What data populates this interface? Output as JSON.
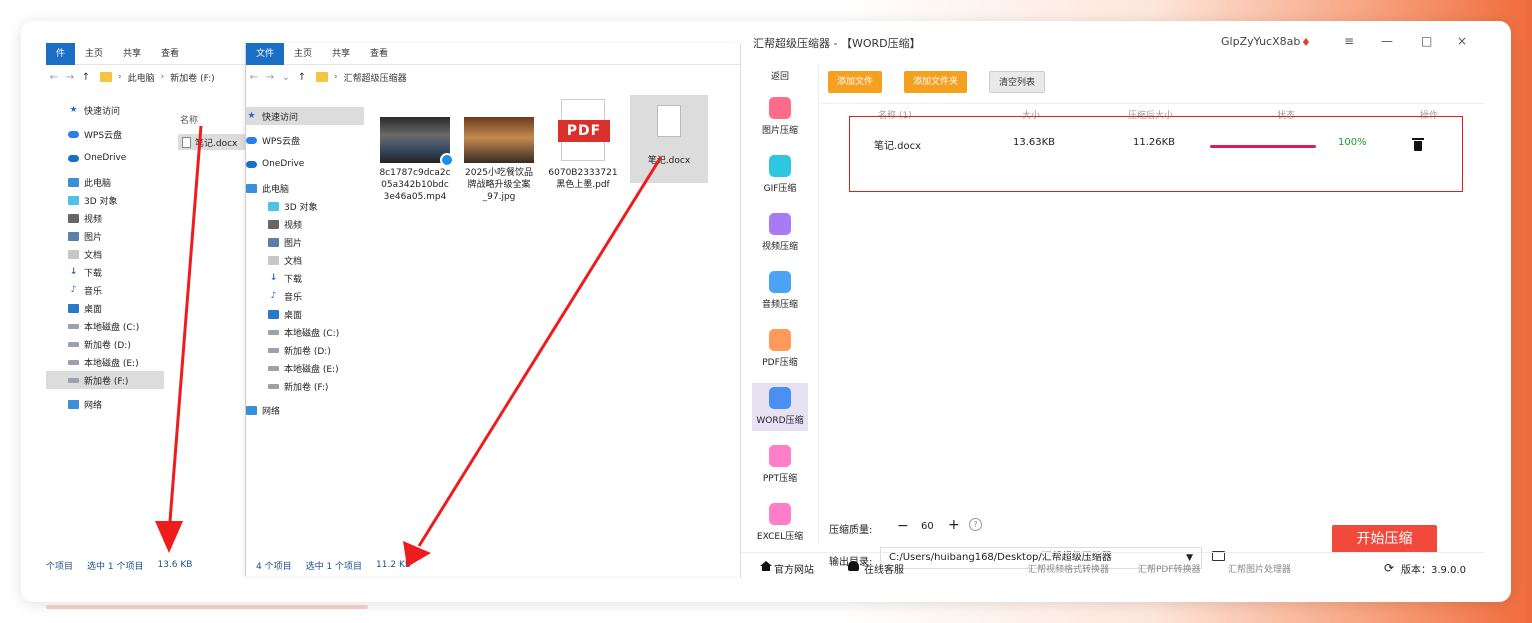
{
  "explorer_left": {
    "ribbon": [
      "件",
      "主页",
      "共享",
      "查看"
    ],
    "address": [
      "此电脑",
      "新加卷 (F:)"
    ],
    "nav": [
      {
        "label": "快速访问",
        "icon": "star-icon",
        "top": true
      },
      {
        "label": "WPS云盘",
        "icon": "cloud-icon",
        "top": true
      },
      {
        "label": "OneDrive",
        "icon": "onedrive-icon",
        "top": true
      },
      {
        "label": "此电脑",
        "icon": "pc-icon",
        "top": true
      },
      {
        "label": "3D 对象",
        "icon": "3d-icon"
      },
      {
        "label": "视频",
        "icon": "video-icon"
      },
      {
        "label": "图片",
        "icon": "picture-icon"
      },
      {
        "label": "文档",
        "icon": "document-icon"
      },
      {
        "label": "下载",
        "icon": "download-icon"
      },
      {
        "label": "音乐",
        "icon": "music-icon"
      },
      {
        "label": "桌面",
        "icon": "desktop-icon"
      },
      {
        "label": "本地磁盘 (C:)",
        "icon": "disk-icon"
      },
      {
        "label": "新加卷 (D:)",
        "icon": "disk-icon"
      },
      {
        "label": "本地磁盘 (E:)",
        "icon": "disk-icon"
      },
      {
        "label": "新加卷 (F:)",
        "icon": "disk-icon",
        "selected": true
      },
      {
        "label": "网络",
        "icon": "network-icon",
        "top": true
      }
    ],
    "col_name": "名称",
    "file": "笔记.docx",
    "status": [
      "个项目",
      "选中 1 个项目",
      "13.6 KB"
    ]
  },
  "explorer_right": {
    "ribbon": [
      "文件",
      "主页",
      "共享",
      "查看"
    ],
    "address": [
      "汇帮超级压缩器"
    ],
    "nav": [
      {
        "label": "快速访问",
        "icon": "star-icon",
        "top": true,
        "selected": true
      },
      {
        "label": "WPS云盘",
        "icon": "cloud-icon",
        "top": true
      },
      {
        "label": "OneDrive",
        "icon": "onedrive-icon",
        "top": true
      },
      {
        "label": "此电脑",
        "icon": "pc-icon",
        "top": true
      },
      {
        "label": "3D 对象",
        "icon": "3d-icon"
      },
      {
        "label": "视频",
        "icon": "video-icon"
      },
      {
        "label": "图片",
        "icon": "picture-icon"
      },
      {
        "label": "文档",
        "icon": "document-icon"
      },
      {
        "label": "下载",
        "icon": "download-icon"
      },
      {
        "label": "音乐",
        "icon": "music-icon"
      },
      {
        "label": "桌面",
        "icon": "desktop-icon"
      },
      {
        "label": "本地磁盘 (C:)",
        "icon": "disk-icon"
      },
      {
        "label": "新加卷 (D:)",
        "icon": "disk-icon"
      },
      {
        "label": "本地磁盘 (E:)",
        "icon": "disk-icon"
      },
      {
        "label": "新加卷 (F:)",
        "icon": "disk-icon"
      },
      {
        "label": "网络",
        "icon": "network-icon",
        "top": true
      }
    ],
    "files": [
      {
        "name1": "8c1787c9dca2c",
        "name2": "05a342b10bdc",
        "name3": "3e46a05.mp4"
      },
      {
        "name1": "2025小吃餐饮品",
        "name2": "牌战略升级全案",
        "name3": "_97.jpg"
      },
      {
        "name1": "6070B2333721",
        "name2": "黑色上墨.pdf",
        "name3": "",
        "badge": "PDF"
      },
      {
        "name1": "笔记.docx",
        "name2": "",
        "name3": ""
      }
    ],
    "status": [
      "4 个项目",
      "选中 1 个项目",
      "11.2 KB"
    ]
  },
  "app": {
    "title": "汇帮超级压缩器 - 【WORD压缩】",
    "user": "GlpZyYucX8ab",
    "window_controls": [
      "≡",
      "—",
      "□",
      "×"
    ],
    "back": "返回",
    "sidebar": [
      {
        "label": "图片压缩",
        "color": "#ff6b8a"
      },
      {
        "label": "GIF压缩",
        "color": "#2ec6e0"
      },
      {
        "label": "视频压缩",
        "color": "#a77bf2"
      },
      {
        "label": "音频压缩",
        "color": "#4aa3f5"
      },
      {
        "label": "PDF压缩",
        "color": "#ff9a5a"
      },
      {
        "label": "WORD压缩",
        "color": "#4a90f2",
        "active": true
      },
      {
        "label": "PPT压缩",
        "color": "#ff7ec8"
      },
      {
        "label": "EXCEL压缩",
        "color": "#ff7ec8"
      }
    ],
    "toolbar": {
      "add_file": "添加文件",
      "add_folder": "添加文件夹",
      "clear": "清空列表"
    },
    "columns": {
      "name": "名称 (1)",
      "size": "大小",
      "compressed": "压缩后大小",
      "status": "状态",
      "action": "操作"
    },
    "row": {
      "name": "笔记.docx",
      "size": "13.63KB",
      "compressed": "11.26KB",
      "progress": 100,
      "percent": "100%"
    },
    "quality": {
      "label": "压缩质量:",
      "minus": "−",
      "value": "60",
      "plus": "+",
      "help": "?"
    },
    "output": {
      "label": "输出目录:",
      "path": "C:/Users/huibang168/Desktop/汇帮超级压缩器"
    },
    "start": "开始压缩",
    "footer": {
      "website": "官方网站",
      "support": "在线客服",
      "link1": "汇帮视频格式转换器",
      "link2": "汇帮PDF转换器",
      "link3": "汇帮图片处理器",
      "version": "版本：3.9.0.0"
    }
  }
}
